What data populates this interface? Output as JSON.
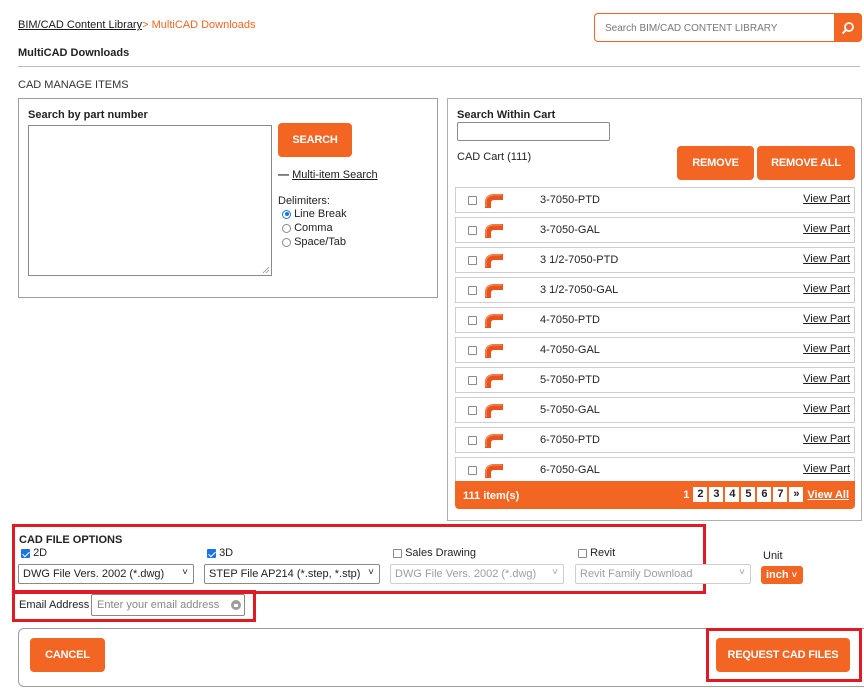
{
  "breadcrumb": {
    "root": "BIM/CAD Content Library",
    "separator": ">",
    "current": "MultiCAD Downloads"
  },
  "page_title": "MultiCAD Downloads",
  "search": {
    "placeholder": "Search BIM/CAD CONTENT LIBRARY"
  },
  "section_title": "CAD MANAGE ITEMS",
  "part_search": {
    "heading": "Search by part number",
    "search_button": "SEARCH",
    "multi_item_prefix": "—",
    "multi_item_link": "Multi-item Search",
    "delimiters_label": "Delimiters:",
    "options": [
      "Line Break",
      "Comma",
      "Space/Tab"
    ],
    "selected": "Line Break"
  },
  "cart": {
    "search_label": "Search Within Cart",
    "title": "CAD Cart (111)",
    "remove_button": "REMOVE",
    "remove_all_button": "REMOVE ALL",
    "view_label": "View Part",
    "items": [
      {
        "part": "3-7050-PTD"
      },
      {
        "part": "3-7050-GAL"
      },
      {
        "part": "3 1/2-7050-PTD"
      },
      {
        "part": "3 1/2-7050-GAL"
      },
      {
        "part": "4-7050-PTD"
      },
      {
        "part": "4-7050-GAL"
      },
      {
        "part": "5-7050-PTD"
      },
      {
        "part": "5-7050-GAL"
      },
      {
        "part": "6-7050-PTD"
      },
      {
        "part": "6-7050-GAL"
      }
    ],
    "footer": {
      "count": "111 item(s)",
      "pages": [
        "1",
        "2",
        "3",
        "4",
        "5",
        "6",
        "7"
      ],
      "next": "»",
      "view_all": "View All"
    }
  },
  "file_options": {
    "title": "CAD FILE OPTIONS",
    "opt_2d": {
      "label": "2D",
      "checked": true,
      "value": "DWG File Vers. 2002 (*.dwg)"
    },
    "opt_3d": {
      "label": "3D",
      "checked": true,
      "value": "STEP File AP214 (*.step, *.stp)"
    },
    "opt_sales": {
      "label": "Sales Drawing",
      "checked": false,
      "value": "DWG File Vers. 2002 (*.dwg)"
    },
    "opt_revit": {
      "label": "Revit",
      "checked": false,
      "value": "Revit Family Download"
    },
    "unit_label": "Unit",
    "unit_value": "inch"
  },
  "email": {
    "label": "Email Address",
    "placeholder": "Enter your email address"
  },
  "actions": {
    "cancel": "CANCEL",
    "request": "REQUEST CAD FILES"
  },
  "colors": {
    "accent": "#f26522",
    "highlight": "#e01b24",
    "link_blue": "#1a73e8"
  }
}
